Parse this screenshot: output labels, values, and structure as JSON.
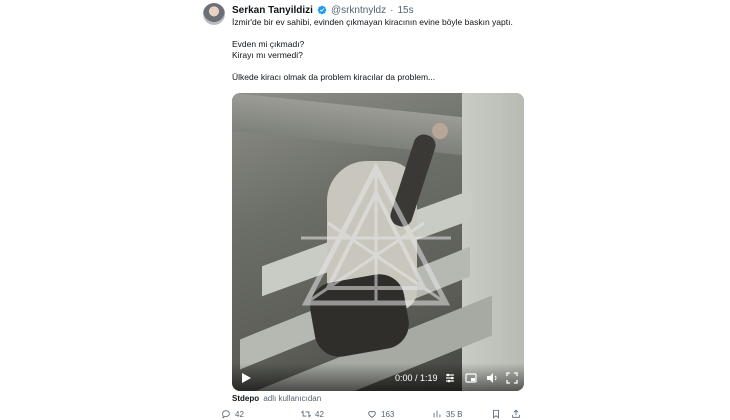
{
  "tweet": {
    "author_name": "Serkan Tanyildizi",
    "handle": "@srkntnyldz",
    "separator": "·",
    "time": "15s",
    "lines": [
      "İzmir'de bir ev sahibi, evinden çıkmayan kiracının evine böyle baskın yaptı.",
      "",
      "Evden mi çıkmadı?",
      "Kirayı mı vermedi?",
      "",
      "Ülkede kiracı olmak da problem kiracılar da problem..."
    ],
    "accent_color": "#1d9bf0"
  },
  "video": {
    "time_display": "0:00 / 1:19",
    "icons": [
      "play-icon",
      "settings-icon",
      "picture-in-picture-icon",
      "fullscreen-icon"
    ]
  },
  "source": {
    "name": "Stdepo",
    "note": "adlı kullanıcıdan"
  },
  "actions": {
    "replies": "42",
    "retweets": "42",
    "likes": "163",
    "views": "35 B"
  }
}
